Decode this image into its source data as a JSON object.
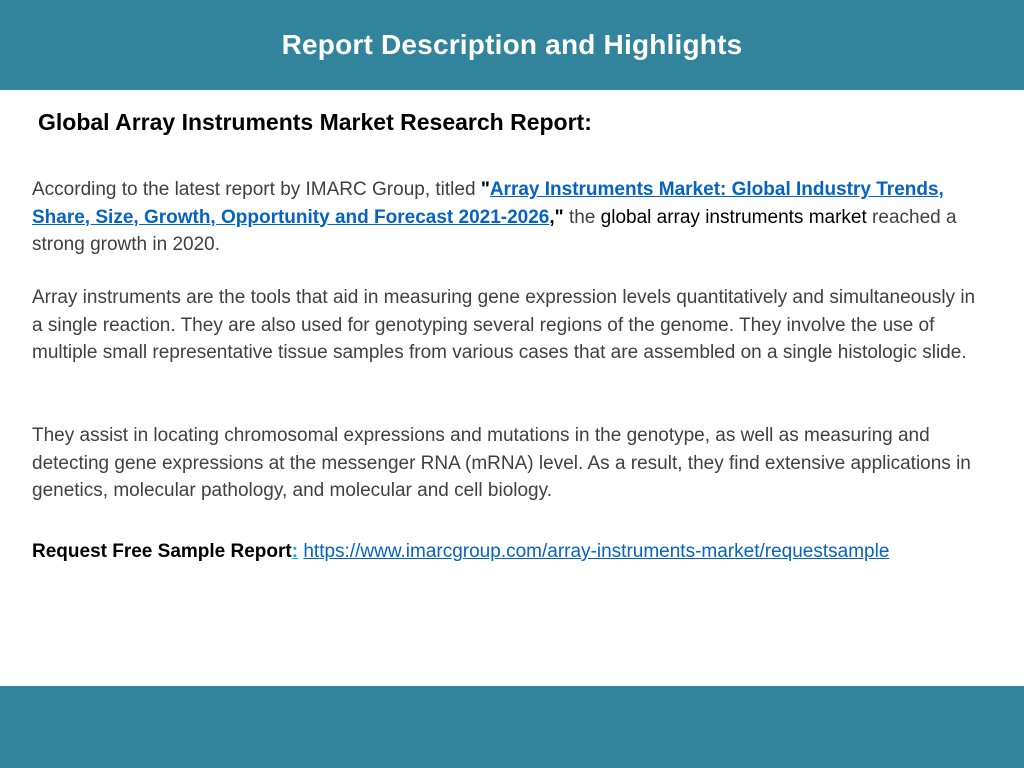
{
  "header": {
    "title": "Report Description and Highlights"
  },
  "main": {
    "heading": "Global Array Instruments Market Research Report:",
    "paragraph1": {
      "intro": "According to the latest report by IMARC Group, titled ",
      "open_quote": "\"",
      "report_link": "Array Instruments Market: Global Industry Trends, Share, Size, Growth, Opportunity and Forecast 2021-2026",
      "close_quote": ",\"",
      "mid": " the ",
      "highlight": "global array instruments market",
      "outro": " reached a strong growth in 2020."
    },
    "paragraph2": "Array instruments are the tools that aid in measuring gene expression levels quantitatively and simultaneously in a single reaction. They are also used for genotyping several regions of the genome. They involve the use of multiple small representative tissue samples from various cases that are assembled on a single histologic slide.",
    "paragraph3": "They assist in locating chromosomal expressions and mutations in the genotype, as well as measuring and detecting gene expressions at the messenger RNA (mRNA) level. As a result, they find extensive applications in genetics, molecular pathology, and molecular and cell biology.",
    "cta": {
      "label": "Request Free Sample Report",
      "colon": ":",
      "space": " ",
      "url": "https://www.imarcgroup.com/array-instruments-market/requestsample"
    }
  },
  "colors": {
    "band": "#31849b",
    "link": "#0563c1",
    "body_text": "#404040"
  }
}
